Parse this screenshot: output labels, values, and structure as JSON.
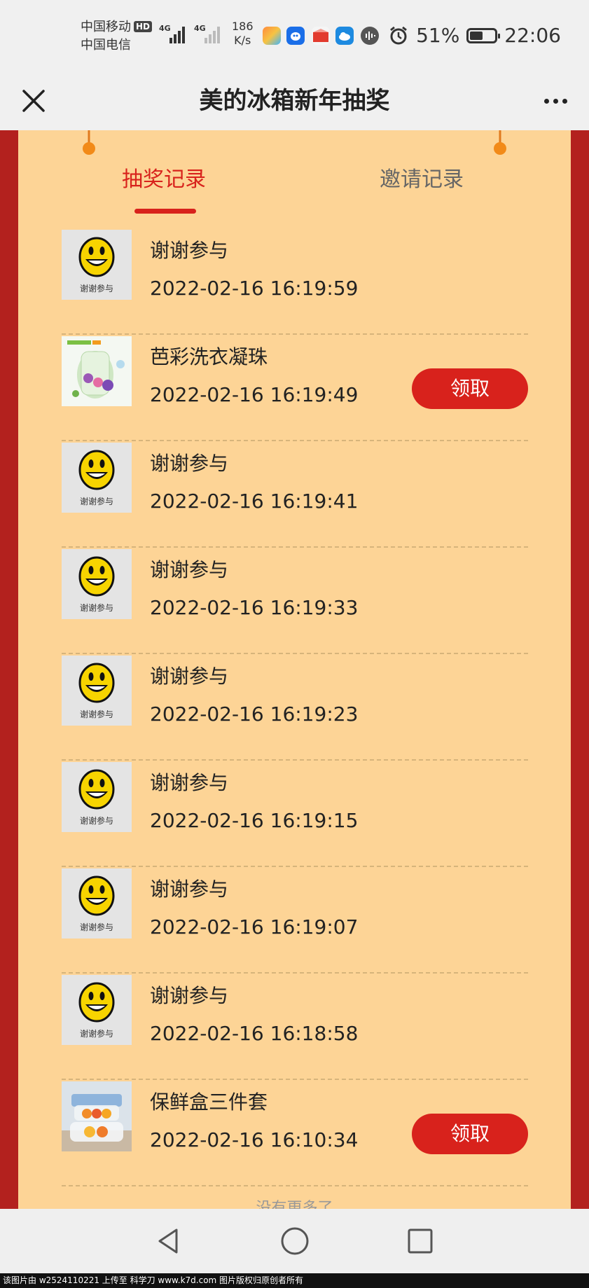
{
  "status_bar": {
    "carrier1": "中国移动",
    "hd_badge": "HD",
    "carrier2": "中国电信",
    "net1": "4G",
    "net2": "4G",
    "speed_value": "186",
    "speed_unit": "K/s",
    "battery_text": "51%",
    "battery_level": 0.51,
    "time": "22:06"
  },
  "navbar": {
    "title": "美的冰箱新年抽奖"
  },
  "tabs": [
    {
      "label": "抽奖记录",
      "active": true
    },
    {
      "label": "邀请记录",
      "active": false
    }
  ],
  "records": [
    {
      "type": "thanks",
      "thumb_caption": "谢谢参与",
      "name": "谢谢参与",
      "time": "2022-02-16 16:19:59",
      "button": ""
    },
    {
      "type": "product",
      "thumb_caption": "",
      "name": "芭彩洗衣凝珠",
      "time": "2022-02-16 16:19:49",
      "button": "领取"
    },
    {
      "type": "thanks",
      "thumb_caption": "谢谢参与",
      "name": "谢谢参与",
      "time": "2022-02-16 16:19:41",
      "button": ""
    },
    {
      "type": "thanks",
      "thumb_caption": "谢谢参与",
      "name": "谢谢参与",
      "time": "2022-02-16 16:19:33",
      "button": ""
    },
    {
      "type": "thanks",
      "thumb_caption": "谢谢参与",
      "name": "谢谢参与",
      "time": "2022-02-16 16:19:23",
      "button": ""
    },
    {
      "type": "thanks",
      "thumb_caption": "谢谢参与",
      "name": "谢谢参与",
      "time": "2022-02-16 16:19:15",
      "button": ""
    },
    {
      "type": "thanks",
      "thumb_caption": "谢谢参与",
      "name": "谢谢参与",
      "time": "2022-02-16 16:19:07",
      "button": ""
    },
    {
      "type": "thanks",
      "thumb_caption": "谢谢参与",
      "name": "谢谢参与",
      "time": "2022-02-16 16:18:58",
      "button": ""
    },
    {
      "type": "product2",
      "thumb_caption": "",
      "name": "保鲜盒三件套",
      "time": "2022-02-16 16:10:34",
      "button": "领取"
    }
  ],
  "footer_note": "没有更多了",
  "watermark": "该图片由 w2524110221 上传至 科学刀 www.k7d.com 图片版权归原创者所有",
  "colors": {
    "accent_red": "#d8221c",
    "card_bg": "#fdd496",
    "outer_red": "#b3211e"
  }
}
